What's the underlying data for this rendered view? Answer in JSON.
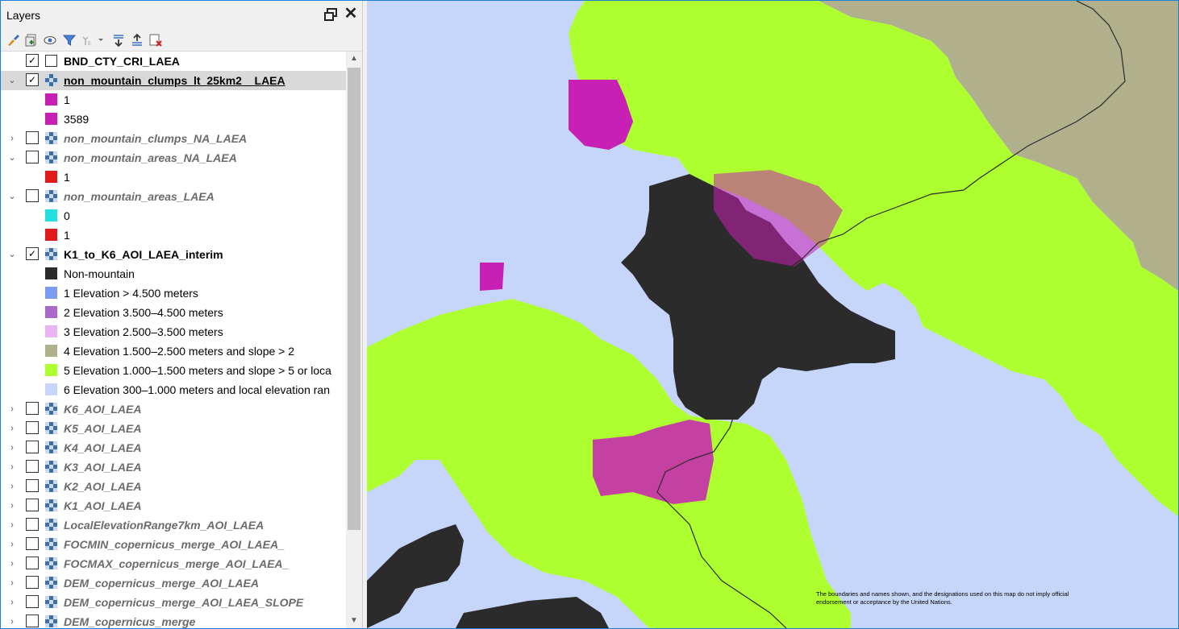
{
  "panel": {
    "title": "Layers",
    "toolbar_icons": [
      "style-brush-icon",
      "add-group-icon",
      "visibility-eye-icon",
      "filter-icon",
      "expression-filter-icon",
      "expand-all-icon",
      "collapse-all-icon",
      "remove-layer-icon"
    ]
  },
  "layers": [
    {
      "name": "BND_CTY_CRI_LAEA",
      "checked": true,
      "style": "bold",
      "expander": "none"
    },
    {
      "name": "non_mountain_clumps_lt_25km2__LAEA",
      "checked": true,
      "style": "bold-underline",
      "expander": "open",
      "selected": true,
      "legend": [
        {
          "label": "1",
          "color": "#c81fb5"
        },
        {
          "label": "3589",
          "color": "#c81fb5"
        }
      ]
    },
    {
      "name": "non_mountain_clumps_NA_LAEA",
      "checked": false,
      "style": "italic",
      "expander": "closed"
    },
    {
      "name": "non_mountain_areas_NA_LAEA",
      "checked": false,
      "style": "italic",
      "expander": "open",
      "legend": [
        {
          "label": "1",
          "color": "#e31a1c"
        }
      ]
    },
    {
      "name": "non_mountain_areas_LAEA",
      "checked": false,
      "style": "italic",
      "expander": "open",
      "legend": [
        {
          "label": "0",
          "color": "#22e0e0"
        },
        {
          "label": "1",
          "color": "#e31a1c"
        }
      ]
    },
    {
      "name": "K1_to_K6_AOI_LAEA_interim",
      "checked": true,
      "style": "bold",
      "expander": "open",
      "legend": [
        {
          "label": "Non-mountain",
          "color": "#2b2b2b"
        },
        {
          "label": "1 Elevation > 4.500 meters",
          "color": "#7b9cf0"
        },
        {
          "label": "2 Elevation 3.500–4.500 meters",
          "color": "#a869c8"
        },
        {
          "label": "3 Elevation 2.500–3.500 meters",
          "color": "#e8b4f4"
        },
        {
          "label": "4 Elevation 1.500–2.500 meters and slope > 2",
          "color": "#b0b08c"
        },
        {
          "label": "5 Elevation 1.000–1.500 meters and slope > 5 or loca",
          "color": "#adff2f"
        },
        {
          "label": "6 Elevation 300–1.000 meters and local elevation ran",
          "color": "#c6d6fb"
        }
      ]
    },
    {
      "name": "K6_AOI_LAEA",
      "checked": false,
      "style": "italic",
      "expander": "closed"
    },
    {
      "name": "K5_AOI_LAEA",
      "checked": false,
      "style": "italic",
      "expander": "closed"
    },
    {
      "name": "K4_AOI_LAEA",
      "checked": false,
      "style": "italic",
      "expander": "closed"
    },
    {
      "name": "K3_AOI_LAEA",
      "checked": false,
      "style": "italic",
      "expander": "closed"
    },
    {
      "name": "K2_AOI_LAEA",
      "checked": false,
      "style": "italic",
      "expander": "closed"
    },
    {
      "name": "K1_AOI_LAEA",
      "checked": false,
      "style": "italic",
      "expander": "closed"
    },
    {
      "name": "LocalElevationRange7km_AOI_LAEA",
      "checked": false,
      "style": "italic",
      "expander": "closed"
    },
    {
      "name": "FOCMIN_copernicus_merge_AOI_LAEA_",
      "checked": false,
      "style": "italic",
      "expander": "closed"
    },
    {
      "name": "FOCMAX_copernicus_merge_AOI_LAEA_",
      "checked": false,
      "style": "italic",
      "expander": "closed"
    },
    {
      "name": "DEM_copernicus_merge_AOI_LAEA",
      "checked": false,
      "style": "italic",
      "expander": "closed"
    },
    {
      "name": "DEM_copernicus_merge_AOI_LAEA_SLOPE",
      "checked": false,
      "style": "italic",
      "expander": "closed"
    },
    {
      "name": "DEM_copernicus_merge",
      "checked": false,
      "style": "italic",
      "expander": "closed"
    }
  ],
  "map": {
    "disclaimer": "The boundaries and names shown, and the designations used on this map do not imply official endorsement or acceptance by the United Nations.",
    "colors": {
      "water": "#c6d6fb",
      "green": "#adff2f",
      "khaki": "#b0b08c",
      "dark": "#2b2b2b",
      "magenta": "#c81fb5",
      "border": "#2a2a2a"
    }
  }
}
